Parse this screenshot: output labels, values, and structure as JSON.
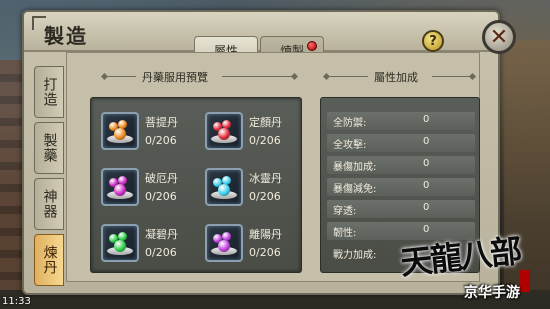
{
  "window": {
    "title": "製造",
    "help_label": "?",
    "close_label": "✕"
  },
  "tabs": [
    {
      "label": "屬性",
      "active": true
    },
    {
      "label": "煉製",
      "active": false,
      "has_alert": true
    }
  ],
  "side_tabs": [
    {
      "label": "打造",
      "active": false
    },
    {
      "label": "製藥",
      "active": false
    },
    {
      "label": "神器",
      "active": false
    },
    {
      "label": "煉丹",
      "active": true
    }
  ],
  "preview": {
    "title": "丹藥服用預覽",
    "items": [
      {
        "name": "菩提丹",
        "count": "0/206",
        "icon": "orange-pill-icon",
        "color": "#f08a1c"
      },
      {
        "name": "定顏丹",
        "count": "0/206",
        "icon": "red-pill-icon",
        "color": "#e02a3a"
      },
      {
        "name": "破厄丹",
        "count": "0/206",
        "icon": "magenta-pill-icon",
        "color": "#d02ac8"
      },
      {
        "name": "冰靈丹",
        "count": "0/206",
        "icon": "cyan-pill-icon",
        "color": "#3ad0f0"
      },
      {
        "name": "凝碧丹",
        "count": "0/206",
        "icon": "green-pill-icon",
        "color": "#2ad048"
      },
      {
        "name": "離陽丹",
        "count": "0/206",
        "icon": "purple-pill-icon",
        "color": "#c040e0"
      }
    ]
  },
  "attributes": {
    "title": "屬性加成",
    "rows": [
      {
        "label": "全防禦:",
        "value": "0"
      },
      {
        "label": "全攻擊:",
        "value": "0"
      },
      {
        "label": "暴傷加成:",
        "value": "0"
      },
      {
        "label": "暴傷減免:",
        "value": "0"
      },
      {
        "label": "穿透:",
        "value": "0"
      },
      {
        "label": "韌性:",
        "value": "0"
      },
      {
        "label": "戰力加成:",
        "value": ""
      }
    ]
  },
  "branding": {
    "logo": "天龍八部",
    "watermark": "京华手游"
  },
  "status": {
    "clock": "11:33"
  },
  "colors": {
    "active_tab": "#f6d890",
    "alert_dot": "#d00000",
    "icon_border": "#8aa0b0"
  }
}
